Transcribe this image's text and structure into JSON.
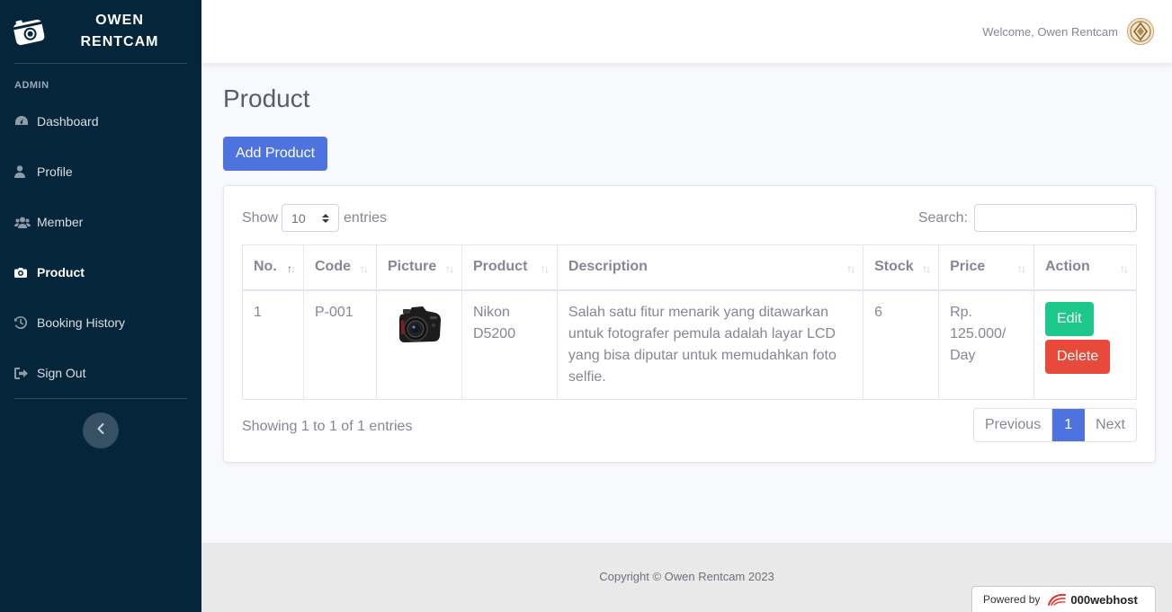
{
  "brand": {
    "line1": "OWEN",
    "line2": "RENTCAM",
    "icon": "camera-icon"
  },
  "sidebar": {
    "heading": "ADMIN",
    "items": [
      {
        "label": "Dashboard",
        "icon": "tachometer-icon",
        "active": false
      },
      {
        "label": "Profile",
        "icon": "user-icon",
        "active": false
      },
      {
        "label": "Member",
        "icon": "users-icon",
        "active": false
      },
      {
        "label": "Product",
        "icon": "camera-icon",
        "active": true
      },
      {
        "label": "Booking History",
        "icon": "history-icon",
        "active": false
      },
      {
        "label": "Sign Out",
        "icon": "sign-out-icon",
        "active": false
      }
    ],
    "toggle_icon": "chevron-left-icon"
  },
  "topbar": {
    "welcome": "Welcome, Owen Rentcam"
  },
  "page": {
    "title": "Product",
    "add_button": "Add Product"
  },
  "table_controls": {
    "show_label": "Show",
    "entries_value": "10",
    "entries_label": "entries",
    "search_label": "Search:",
    "search_value": ""
  },
  "table": {
    "headers": [
      "No.",
      "Code",
      "Picture",
      "Product",
      "Description",
      "Stock",
      "Price",
      "Action"
    ],
    "rows": [
      {
        "no": "1",
        "code": "P-001",
        "picture": "camera-photo",
        "product": "Nikon D5200",
        "description": "Salah satu fitur menarik yang ditawarkan untuk fotografer pemula adalah layar LCD yang bisa diputar untuk memudahkan foto selfie.",
        "stock": "6",
        "price": "Rp. 125.000/ Day",
        "edit_label": "Edit",
        "delete_label": "Delete"
      }
    ],
    "info": "Showing 1 to 1 of 1 entries",
    "pager": {
      "previous": "Previous",
      "current": "1",
      "next": "Next"
    }
  },
  "footer": {
    "copyright": "Copyright © Owen Rentcam 2023",
    "powered_by": "Powered by",
    "host": "000webhost"
  },
  "colors": {
    "sidebar_bg": "#05253b",
    "primary": "#4e73df",
    "success": "#1cc88a",
    "danger": "#e74a3b"
  }
}
